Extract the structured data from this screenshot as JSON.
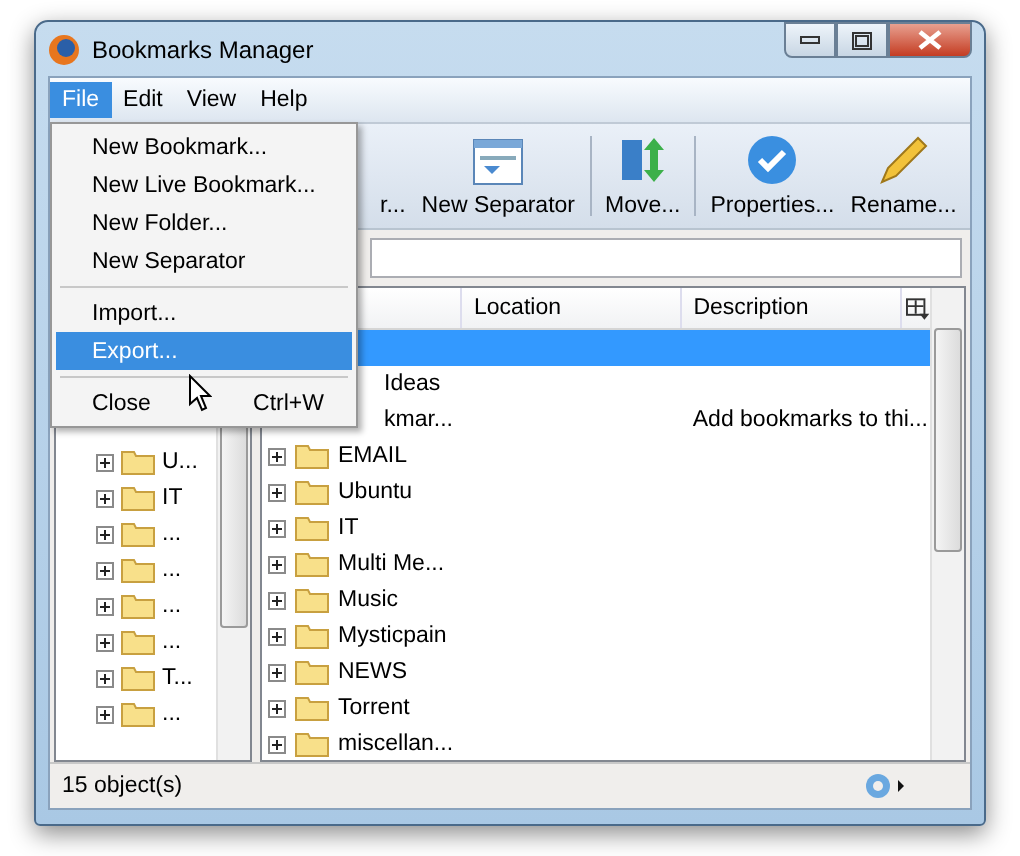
{
  "window": {
    "title": "Bookmarks Manager"
  },
  "menubar": [
    {
      "label": "File",
      "selected": true
    },
    {
      "label": "Edit",
      "selected": false
    },
    {
      "label": "View",
      "selected": false
    },
    {
      "label": "Help",
      "selected": false
    }
  ],
  "toolbar": [
    {
      "label": "r..."
    },
    {
      "label": "New Separator"
    },
    {
      "label": "Move..."
    },
    {
      "label": "Properties..."
    },
    {
      "label": "Rename..."
    }
  ],
  "tree": [
    {
      "label": "U..."
    },
    {
      "label": "IT"
    },
    {
      "label": "..."
    },
    {
      "label": "..."
    },
    {
      "label": "..."
    },
    {
      "label": "..."
    },
    {
      "label": "T..."
    },
    {
      "label": "..."
    }
  ],
  "table": {
    "columns": [
      "Location",
      "Description"
    ],
    "rows": [
      {
        "kind": "covered",
        "name": "",
        "description": "",
        "selected": true
      },
      {
        "kind": "covered",
        "name": "Ideas",
        "description": "",
        "selected": false
      },
      {
        "kind": "covered",
        "name": "kmar...",
        "description": "Add bookmarks to thi...",
        "selected": false
      },
      {
        "kind": "folder",
        "name": "EMAIL",
        "description": "",
        "selected": false
      },
      {
        "kind": "folder",
        "name": "Ubuntu",
        "description": "",
        "selected": false
      },
      {
        "kind": "folder",
        "name": "IT",
        "description": "",
        "selected": false
      },
      {
        "kind": "folder",
        "name": "Multi Me...",
        "description": "",
        "selected": false
      },
      {
        "kind": "folder",
        "name": "Music",
        "description": "",
        "selected": false
      },
      {
        "kind": "folder",
        "name": "Mysticpain",
        "description": "",
        "selected": false
      },
      {
        "kind": "folder",
        "name": "NEWS",
        "description": "",
        "selected": false
      },
      {
        "kind": "folder",
        "name": "Torrent",
        "description": "",
        "selected": false
      },
      {
        "kind": "folder",
        "name": "miscellan...",
        "description": "",
        "selected": false
      }
    ]
  },
  "status_bar": {
    "text": "15 object(s)"
  },
  "file_menu": [
    {
      "kind": "item",
      "label": "New Bookmark...",
      "selected": false
    },
    {
      "kind": "item",
      "label": "New Live Bookmark...",
      "selected": false
    },
    {
      "kind": "item",
      "label": "New Folder...",
      "selected": false
    },
    {
      "kind": "item",
      "label": "New Separator",
      "selected": false
    },
    {
      "kind": "separator"
    },
    {
      "kind": "item",
      "label": "Import...",
      "selected": false
    },
    {
      "kind": "item",
      "label": "Export...",
      "selected": true
    },
    {
      "kind": "separator"
    },
    {
      "kind": "item",
      "label": "Close",
      "shortcut": "Ctrl+W",
      "selected": false
    }
  ]
}
